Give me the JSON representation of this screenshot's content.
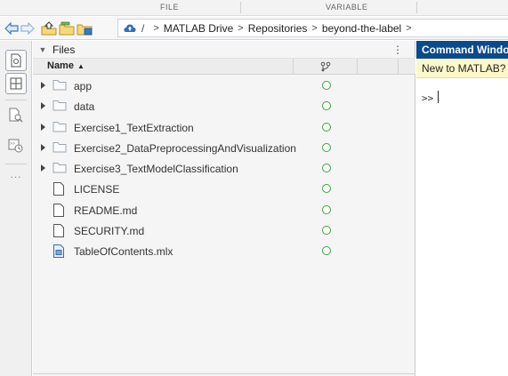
{
  "toolstrip": {
    "sections": [
      "FILE",
      "VARIABLE"
    ]
  },
  "addressbar": {
    "back_icon": "back-arrow-icon",
    "forward_icon": "forward-arrow-icon",
    "up_icon": "up-folder-icon",
    "browse_icon": "browse-folder-icon",
    "drive_icon": "matlab-drive-cloud-icon",
    "root": "/",
    "crumbs": [
      "MATLAB Drive",
      "Repositories",
      "beyond-the-label"
    ]
  },
  "rail": {
    "buttons": [
      "files-panel-icon",
      "workspace-panel-icon",
      "find-files-icon",
      "command-history-icon"
    ],
    "more": "..."
  },
  "files_panel": {
    "title": "Files",
    "menu_icon": "⋮",
    "columns": {
      "name": "Name",
      "sort": "▲",
      "source_control_icon": "source-control-icon"
    },
    "items": [
      {
        "name": "app",
        "type": "folder"
      },
      {
        "name": "data",
        "type": "folder"
      },
      {
        "name": "Exercise1_TextExtraction",
        "type": "folder"
      },
      {
        "name": "Exercise2_DataPreprocessingAndVisualization",
        "type": "folder"
      },
      {
        "name": "Exercise3_TextModelClassification",
        "type": "folder"
      },
      {
        "name": "LICENSE",
        "type": "file"
      },
      {
        "name": "README.md",
        "type": "file"
      },
      {
        "name": "SECURITY.md",
        "type": "file"
      },
      {
        "name": "TableOfContents.mlx",
        "type": "live-script"
      }
    ],
    "status_color": "#3aa53a"
  },
  "command_window": {
    "title": "Command Windo",
    "notice": "New to MATLAB?",
    "prompt": ">>"
  },
  "colors": {
    "command_title_bg": "#0b4a8c",
    "notice_bg": "#fdf7c9",
    "folder_outline": "#9aa7b3"
  }
}
